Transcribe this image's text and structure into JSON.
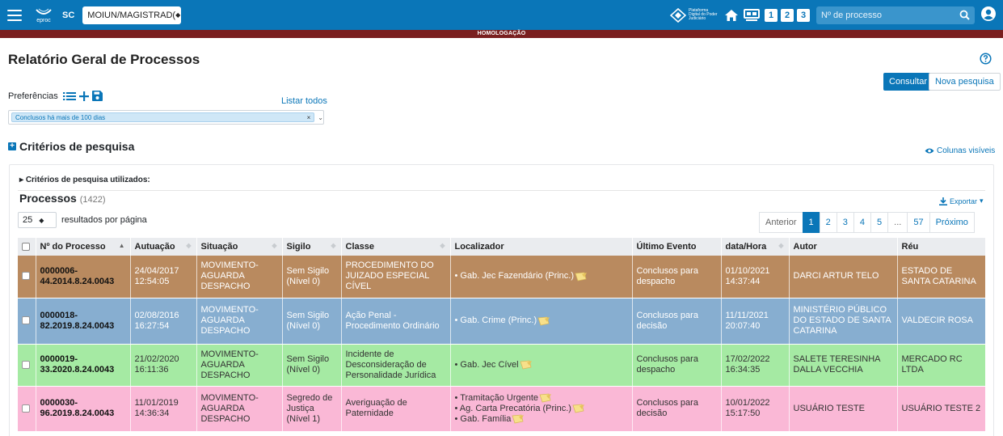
{
  "header": {
    "logo_text": "eproc",
    "state": "SC",
    "profile_select": "MOIUN/MAGISTRAD(",
    "pdpj_logo_text": "Plataforma Digital do Poder Judiciário",
    "quick_buttons": [
      "1",
      "2",
      "3"
    ],
    "search_placeholder": "Nº de processo"
  },
  "environment_banner": "HOMOLOGAÇÃO",
  "page": {
    "title": "Relatório Geral de Processos",
    "consultar_label": "Consultar",
    "nova_pesquisa_label": "Nova pesquisa"
  },
  "preferences": {
    "label": "Preferências",
    "listar_todos": "Listar todos",
    "selected_tag": "Conclusos há mais de 100 dias"
  },
  "criterios": {
    "title": "Critérios de pesquisa",
    "colunas_visiveis": "Colunas visíveis",
    "utilizados": "Critérios de pesquisa utilizados:"
  },
  "processos": {
    "title": "Processos",
    "count": "(1422)",
    "exportar": "Exportar",
    "per_page_value": "25",
    "per_page_label": "resultados por página"
  },
  "pagination": {
    "prev": "Anterior",
    "pages": [
      "1",
      "2",
      "3",
      "4",
      "5",
      "...",
      "57"
    ],
    "next": "Próximo",
    "current": "1"
  },
  "table": {
    "columns": [
      "Nº do Processo",
      "Autuação",
      "Situação",
      "Sigilo",
      "Classe",
      "Localizador",
      "Último Evento",
      "data/Hora",
      "Autor",
      "Réu"
    ],
    "rows": [
      {
        "color": "#b98a5f",
        "numero": "0000006-44.2014.8.24.0043",
        "autuacao": "24/04/2017 12:54:05",
        "situacao": "MOVIMENTO-AGUARDA DESPACHO",
        "sigilo": "Sem Sigilo (Nível 0)",
        "classe": "PROCEDIMENTO DO JUIZADO ESPECIAL CÍVEL",
        "localizadores": [
          "• Gab. Jec Fazendário (Princ.)"
        ],
        "ultimo_evento": "Conclusos para despacho",
        "data_hora": "01/10/2021 14:37:44",
        "autor": "DARCI ARTUR TELO",
        "reu": "ESTADO DE SANTA CATARINA"
      },
      {
        "color": "#87aed0",
        "numero": "0000018-82.2019.8.24.0043",
        "autuacao": "02/08/2016 16:27:54",
        "situacao": "MOVIMENTO-AGUARDA DESPACHO",
        "sigilo": "Sem Sigilo (Nível 0)",
        "classe": "Ação Penal - Procedimento Ordinário",
        "localizadores": [
          "• Gab. Crime (Princ.)"
        ],
        "ultimo_evento": "Conclusos para decisão",
        "data_hora": "11/11/2021 20:07:40",
        "autor": "MINISTÉRIO PÚBLICO DO ESTADO DE SANTA CATARINA",
        "reu": "VALDECIR ROSA"
      },
      {
        "color": "#a5eaa3",
        "numero": "0000019-33.2020.8.24.0043",
        "autuacao": "21/02/2020 16:11:36",
        "situacao": "MOVIMENTO-AGUARDA DESPACHO",
        "sigilo": "Sem Sigilo (Nível 0)",
        "classe": "Incidente de Desconsideração de Personalidade Jurídica",
        "localizadores": [
          "• Gab. Jec Cível"
        ],
        "ultimo_evento": "Conclusos para despacho",
        "data_hora": "17/02/2022 16:34:35",
        "autor": "SALETE TERESINHA DALLA VECCHIA",
        "reu": "MERCADO RC LTDA"
      },
      {
        "color": "#fab8d6",
        "numero": "0000030-96.2019.8.24.0043",
        "autuacao": "11/01/2019 14:36:34",
        "situacao": "MOVIMENTO-AGUARDA DESPACHO",
        "sigilo": "Segredo de Justiça (Nível 1)",
        "classe": "Averiguação de Paternidade",
        "localizadores": [
          "• Tramitação Urgente",
          "• Ag. Carta Precatória (Princ.)",
          "• Gab. Família"
        ],
        "ultimo_evento": "Conclusos para decisão",
        "data_hora": "10/01/2022 15:17:50",
        "autor": "USUÁRIO TESTE",
        "reu": "USUÁRIO TESTE 2"
      }
    ]
  }
}
